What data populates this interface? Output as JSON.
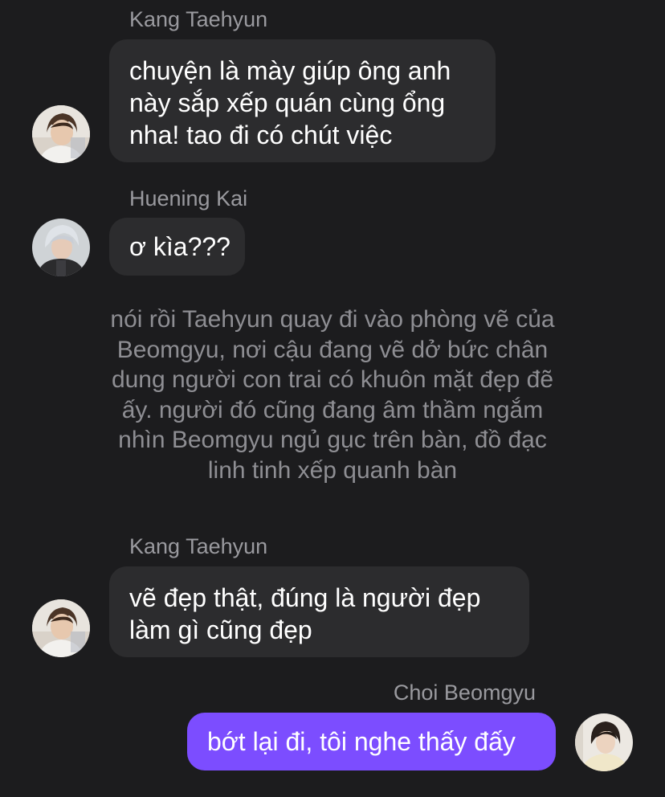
{
  "messages": [
    {
      "sender": "Kang Taehyun",
      "lines": [
        "chuyện là mày giúp ông anh",
        "này sắp xếp quán cùng ổng",
        "nha! tao đi có chút việc"
      ]
    },
    {
      "sender": "Huening Kai",
      "lines": [
        "ơ kìa???"
      ]
    },
    {
      "narration_lines": [
        "nói rồi Taehyun quay đi vào phòng vẽ của",
        "Beomgyu, nơi cậu đang vẽ dở bức chân",
        "dung người con trai có khuôn mặt đẹp đẽ",
        "ấy. người đó cũng đang âm thầm ngắm",
        "nhìn Beomgyu ngủ gục trên bàn, đồ đạc",
        "linh tinh xếp quanh bàn"
      ]
    },
    {
      "sender": "Kang Taehyun",
      "lines": [
        "vẽ đẹp thật, đúng là người đẹp",
        "làm gì cũng đẹp"
      ]
    },
    {
      "sender": "Choi Beomgyu",
      "lines": [
        "bớt lại đi, tôi nghe thấy đấy"
      ]
    }
  ],
  "colors": {
    "background": "#1c1c1e",
    "incoming_bubble": "#2c2c2e",
    "outgoing_bubble": "#7c4dff",
    "sender_name": "#9a9a9f",
    "narration": "#8e8e93",
    "message_text": "#ffffff"
  }
}
